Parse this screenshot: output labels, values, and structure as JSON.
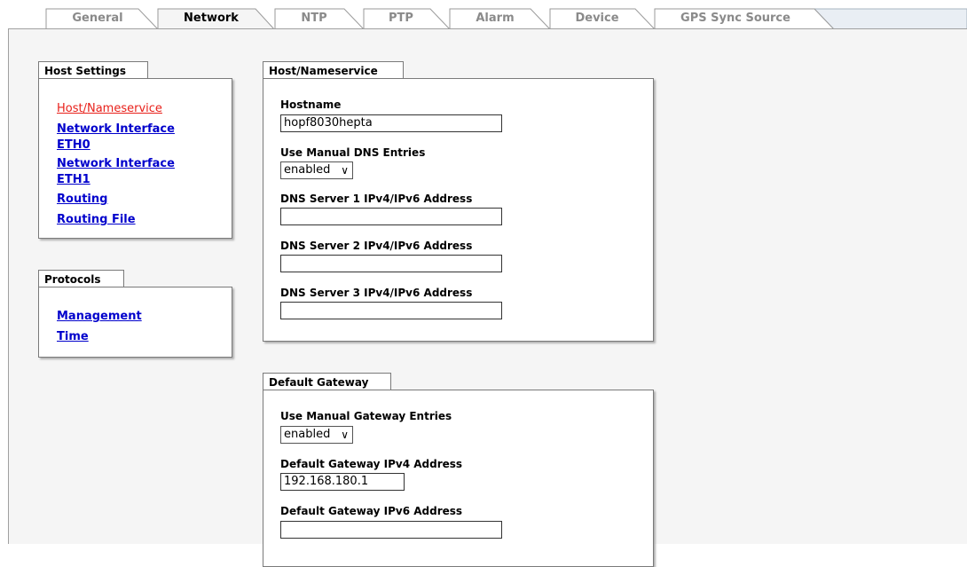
{
  "tabs": [
    {
      "label": "General",
      "active": false
    },
    {
      "label": "Network",
      "active": true
    },
    {
      "label": "NTP",
      "active": false
    },
    {
      "label": "PTP",
      "active": false
    },
    {
      "label": "Alarm",
      "active": false
    },
    {
      "label": "Device",
      "active": false
    },
    {
      "label": "GPS Sync Source",
      "active": false
    }
  ],
  "sidebar": {
    "host_settings": {
      "title": "Host Settings",
      "links": [
        {
          "label": "Host/Nameservice",
          "current": true
        },
        {
          "label": "Network Interface ETH0",
          "line1": "Network Interface",
          "line2": "ETH0"
        },
        {
          "label": "Network Interface ETH1",
          "line1": "Network Interface",
          "line2": "ETH1"
        },
        {
          "label": "Routing"
        },
        {
          "label": "Routing File"
        }
      ]
    },
    "protocols": {
      "title": "Protocols",
      "links": [
        {
          "label": "Management"
        },
        {
          "label": "Time"
        }
      ]
    }
  },
  "host_nameservice": {
    "title": "Host/Nameservice",
    "hostname_label": "Hostname",
    "hostname_value": "hopf8030hepta",
    "manual_dns_label": "Use Manual DNS Entries",
    "manual_dns_value": "enabled",
    "dns1_label": "DNS Server 1 IPv4/IPv6 Address",
    "dns1_value": "",
    "dns2_label": "DNS Server 2 IPv4/IPv6 Address",
    "dns2_value": "",
    "dns3_label": "DNS Server 3 IPv4/IPv6 Address",
    "dns3_value": ""
  },
  "default_gateway": {
    "title": "Default Gateway",
    "manual_gw_label": "Use Manual Gateway Entries",
    "manual_gw_value": "enabled",
    "ipv4_label": "Default Gateway IPv4 Address",
    "ipv4_value": "192.168.180.1",
    "ipv6_label": "Default Gateway IPv6 Address",
    "ipv6_value": ""
  }
}
